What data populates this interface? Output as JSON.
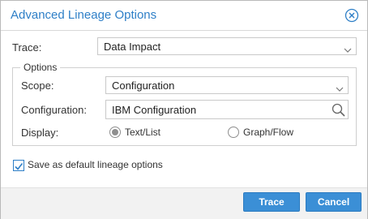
{
  "dialog": {
    "title": "Advanced Lineage Options",
    "accent_color": "#2e7fc7",
    "close_icon": "close-circle-icon"
  },
  "trace": {
    "label": "Trace:",
    "value": "Data Impact",
    "icon": "chevron-down-icon"
  },
  "options": {
    "legend": "Options",
    "scope": {
      "label": "Scope:",
      "value": "Configuration",
      "icon": "chevron-down-icon"
    },
    "configuration": {
      "label": "Configuration:",
      "value": "IBM Configuration",
      "icon": "search-icon"
    },
    "display": {
      "label": "Display:",
      "choices": [
        {
          "label": "Text/List",
          "selected": true
        },
        {
          "label": "Graph/Flow",
          "selected": false
        }
      ]
    }
  },
  "default_option": {
    "label": "Save as default lineage options",
    "checked": true
  },
  "buttons": {
    "trace_label": "Trace",
    "cancel_label": "Cancel",
    "color": "#3b8fd6"
  }
}
